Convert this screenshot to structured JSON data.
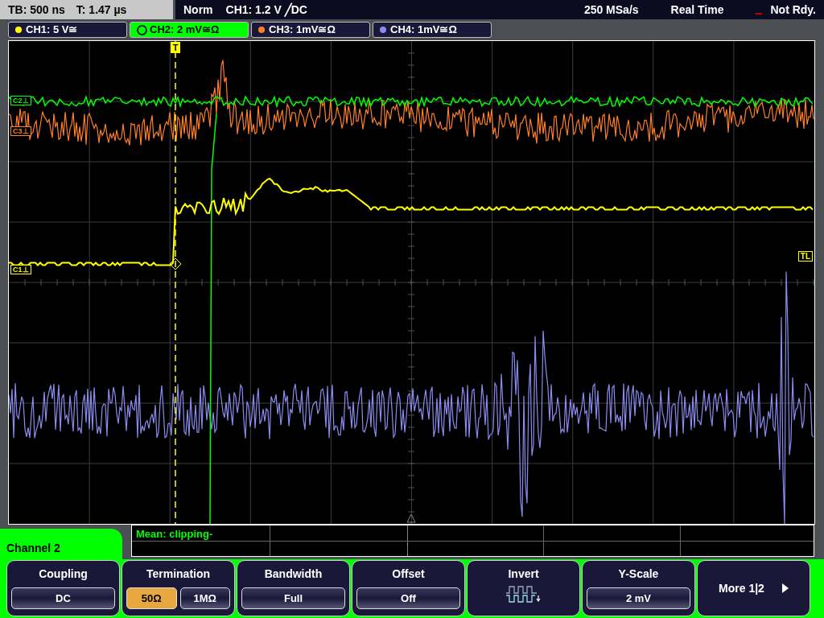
{
  "status_bar": {
    "timebase": "TB: 500 ns",
    "trigger_time": "T: 1.47 µs",
    "mode": "Norm",
    "trigger": "CH1: 1.2 V ╱DC",
    "sample_rate": "250 MSa/s",
    "acquisition": "Real Time",
    "state": "Not Rdy."
  },
  "channels": [
    {
      "label": "CH1: 5 V≅",
      "color": "#ffff00",
      "selected": false
    },
    {
      "label": "CH2: 2 mV≅Ω",
      "color": "#00ff00",
      "selected": true
    },
    {
      "label": "CH3: 1mV≅Ω",
      "color": "#ff7f2a",
      "selected": false
    },
    {
      "label": "CH4: 1mV≅Ω",
      "color": "#8c8cf0",
      "selected": false
    }
  ],
  "plot": {
    "trigger_marker": "T",
    "trigger_level_marker": "TL",
    "channel_markers": [
      "C2⊥",
      "C3⊥",
      "C1⊥"
    ]
  },
  "measurement": {
    "text": "Mean: clipping-"
  },
  "menu": {
    "title": "Channel 2",
    "keys": [
      {
        "kind": "select",
        "label": "Coupling",
        "value": "DC"
      },
      {
        "kind": "options",
        "label": "Termination",
        "options": [
          {
            "label": "50Ω",
            "selected": true
          },
          {
            "label": "1MΩ",
            "selected": false
          }
        ]
      },
      {
        "kind": "select",
        "label": "Bandwidth",
        "value": "Full"
      },
      {
        "kind": "select",
        "label": "Offset",
        "value": "Off"
      },
      {
        "kind": "icon",
        "label": "Invert"
      },
      {
        "kind": "select",
        "label": "Y-Scale",
        "value": "2 mV"
      },
      {
        "kind": "next",
        "label": "More 1|2"
      }
    ]
  }
}
